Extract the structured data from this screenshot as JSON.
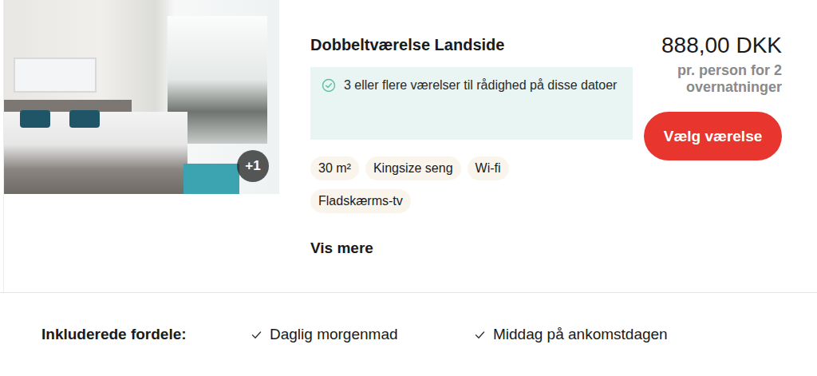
{
  "room": {
    "title": "Dobbeltværelse Landside",
    "photo_count": "+1",
    "availability": "3 eller flere værelser til rådighed på disse datoer",
    "features": [
      "30 m²",
      "Kingsize seng",
      "Wi-fi",
      "Fladskærms-tv"
    ],
    "more_link": "Vis mere",
    "price": "888,00 DKK",
    "price_note": "pr. person for 2 overnatninger",
    "select_button": "Vælg værelse"
  },
  "benefits": {
    "label": "Inkluderede fordele:",
    "items": [
      "Daglig morgenmad",
      "Middag på ankomstdagen"
    ]
  }
}
